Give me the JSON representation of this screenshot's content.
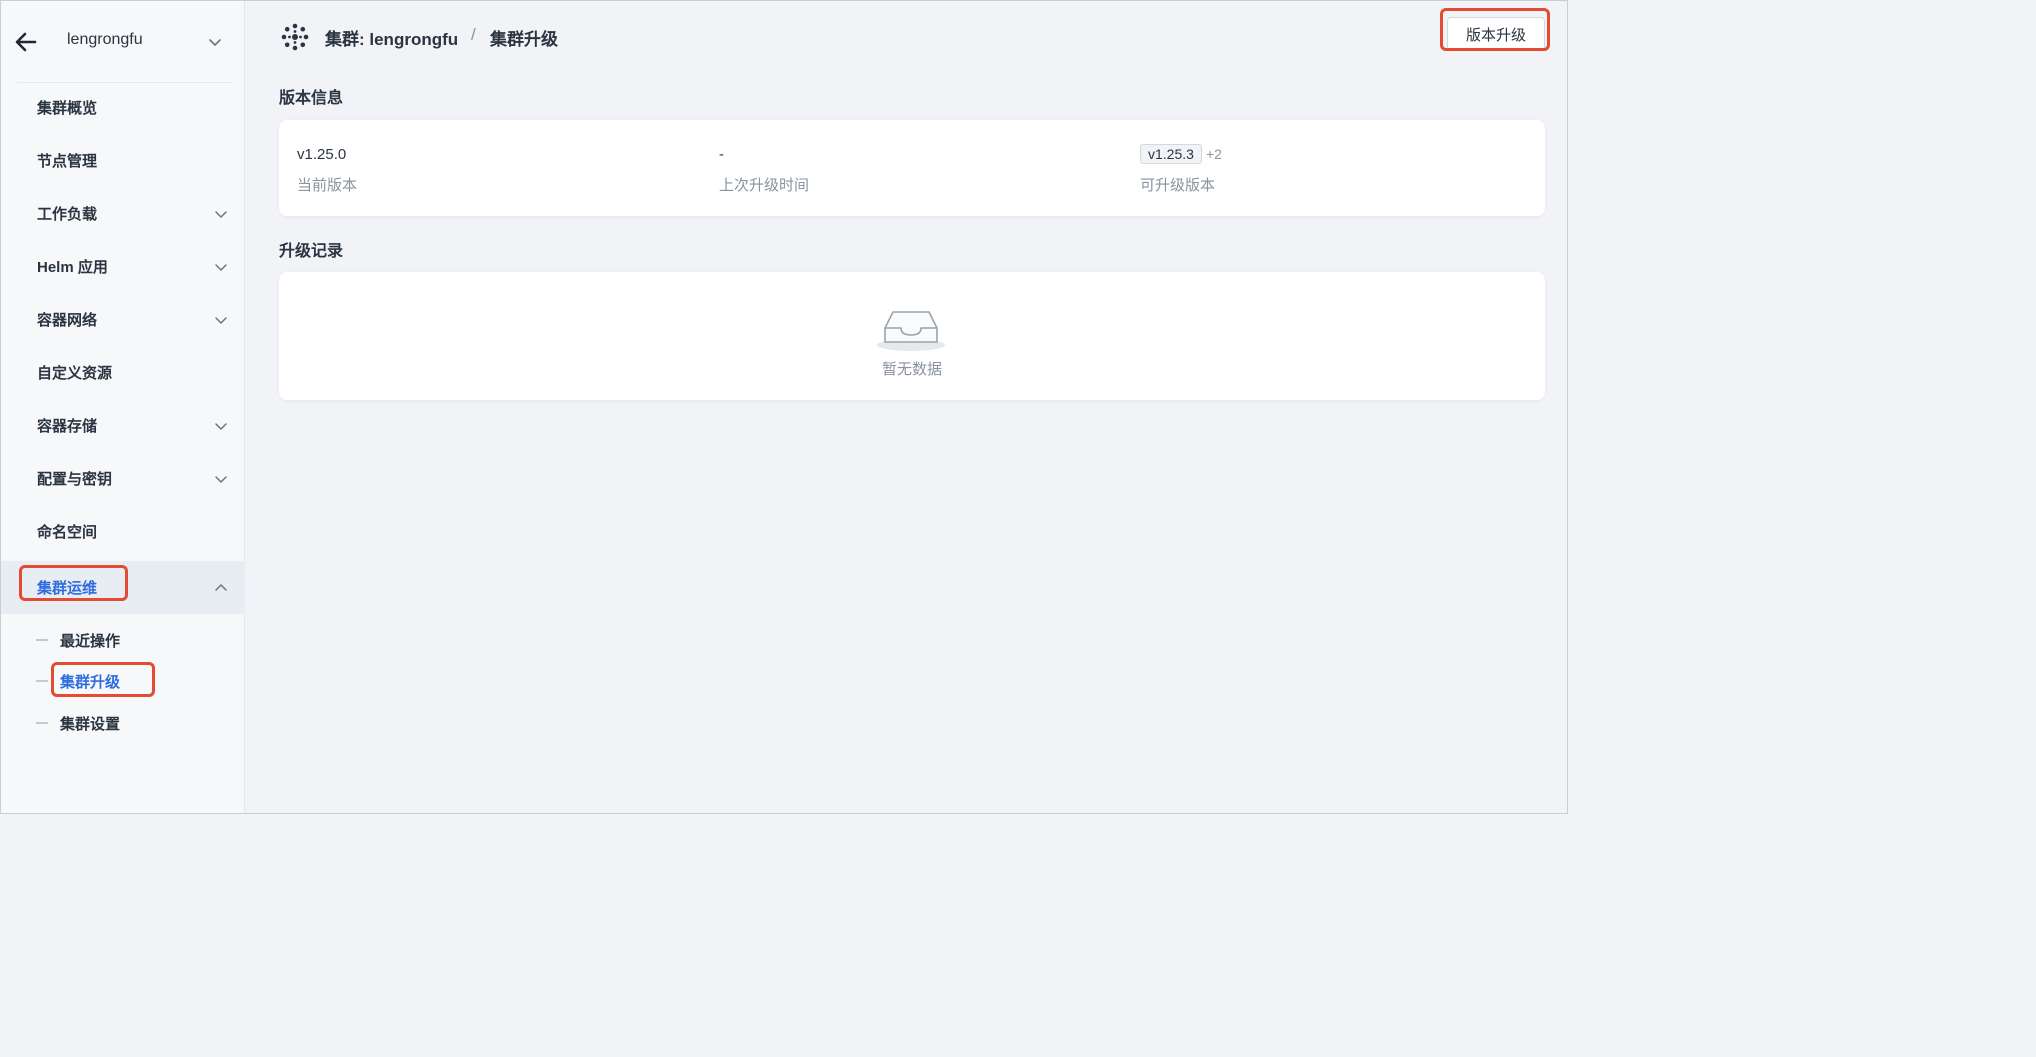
{
  "sidebar": {
    "cluster_name": "lengrongfu",
    "items": [
      {
        "label": "集群概览"
      },
      {
        "label": "节点管理"
      },
      {
        "label": "工作负载"
      },
      {
        "label": "Helm 应用"
      },
      {
        "label": "容器网络"
      },
      {
        "label": "自定义资源"
      },
      {
        "label": "容器存储"
      },
      {
        "label": "配置与密钥"
      },
      {
        "label": "命名空间"
      },
      {
        "label": "集群运维"
      }
    ],
    "sub_items": [
      {
        "label": "最近操作"
      },
      {
        "label": "集群升级"
      },
      {
        "label": "集群设置"
      }
    ]
  },
  "header": {
    "crumb_cluster": "集群: lengrongfu",
    "crumb_separator": "/",
    "crumb_page": "集群升级",
    "upgrade_button": "版本升级"
  },
  "version_info": {
    "title": "版本信息",
    "current_version": "v1.25.0",
    "current_version_label": "当前版本",
    "last_upgrade_time": "-",
    "last_upgrade_time_label": "上次升级时间",
    "available_version": "v1.25.3",
    "available_more": "+2",
    "available_label": "可升级版本"
  },
  "upgrade_records": {
    "title": "升级记录",
    "empty_text": "暂无数据"
  },
  "colors": {
    "accent": "#2f6cdf",
    "highlight_box": "#e34b32",
    "page_bg": "#f1f3f7"
  }
}
